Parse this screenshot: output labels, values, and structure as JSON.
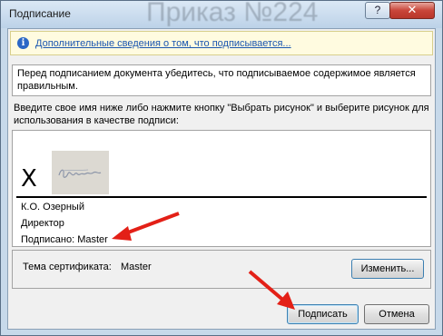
{
  "window": {
    "title": "Подписание",
    "background_title": "Приказ №224",
    "help_label": "?",
    "close_label": "✕"
  },
  "info_bar": {
    "icon": "info-icon",
    "link_text": "Дополнительные сведения о том, что подписывается..."
  },
  "message": "Перед подписанием документа убедитесь, что подписываемое содержимое является правильным.",
  "instructions": "Введите свое имя ниже либо нажмите кнопку \"Выбрать рисунок\" и выберите рисунок для использования в качестве подписи:",
  "signature": {
    "x_mark": "X",
    "name": "К.О. Озерный",
    "title": "Директор",
    "signed_by": "Подписано: Master"
  },
  "certificate": {
    "label": "Тема сертификата:",
    "value": "Master",
    "change_button": "Изменить..."
  },
  "buttons": {
    "sign": "Подписать",
    "cancel": "Отмена"
  },
  "colors": {
    "annotation_arrow": "#e32017",
    "link": "#1a56b0",
    "info_bar_bg": "#fffbe0"
  }
}
